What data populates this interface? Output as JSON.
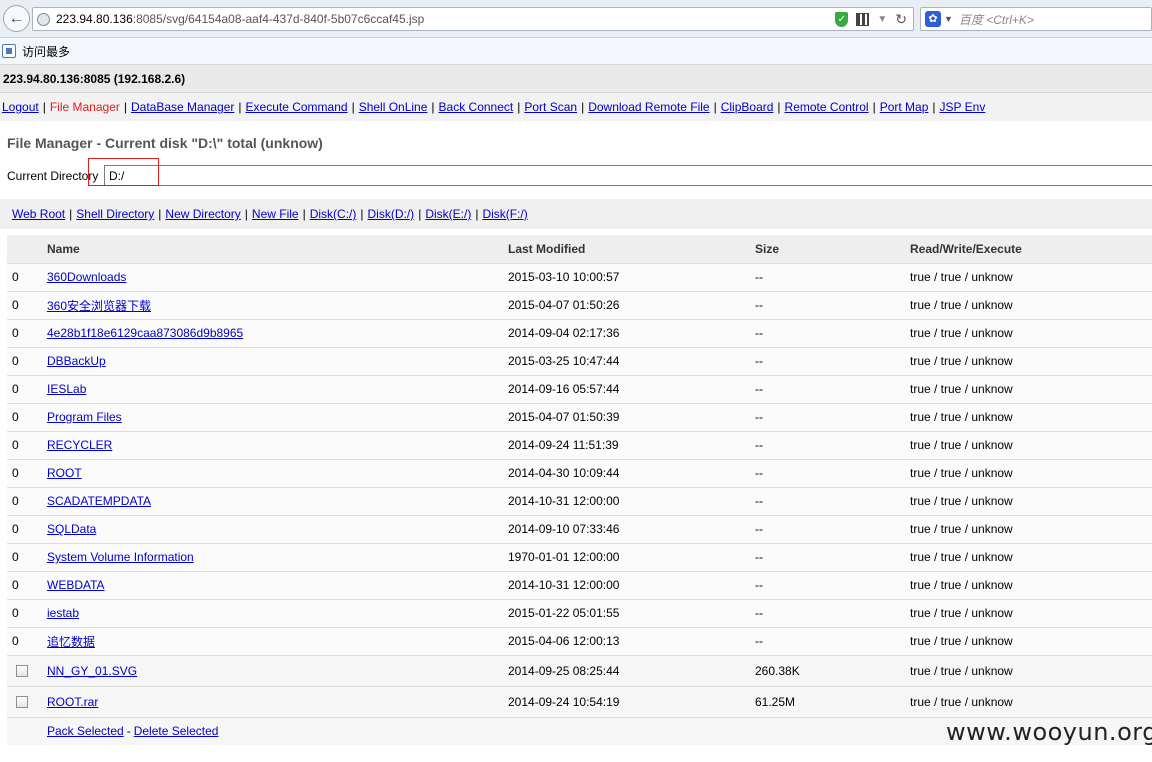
{
  "browser": {
    "url_host": "223.94.80.136",
    "url_rest": ":8085/svg/64154a08-aaf4-437d-840f-5b07c6ccaf45.jsp",
    "search_placeholder": "百度 <Ctrl+K>",
    "bookmark_label": "访问最多"
  },
  "page": {
    "host_line": "223.94.80.136:8085 (192.168.2.6)",
    "nav": [
      {
        "label": "Logout",
        "active": false
      },
      {
        "label": "File Manager",
        "active": true
      },
      {
        "label": "DataBase Manager",
        "active": false
      },
      {
        "label": "Execute Command",
        "active": false
      },
      {
        "label": "Shell OnLine",
        "active": false
      },
      {
        "label": "Back Connect",
        "active": false
      },
      {
        "label": "Port Scan",
        "active": false
      },
      {
        "label": "Download Remote File",
        "active": false
      },
      {
        "label": "ClipBoard",
        "active": false
      },
      {
        "label": "Remote Control",
        "active": false
      },
      {
        "label": "Port Map",
        "active": false
      },
      {
        "label": "JSP Env",
        "active": false
      }
    ],
    "title": "File Manager - Current disk \"D:\\\" total (unknow)",
    "current_dir_label": "Current Directory",
    "current_dir_value": "D:/",
    "quick_links": [
      "Web Root",
      "Shell Directory",
      "New Directory",
      "New File",
      "Disk(C:/)",
      "Disk(D:/)",
      "Disk(E:/)",
      "Disk(F:/)"
    ],
    "table": {
      "headers": [
        "",
        "Name",
        "Last Modified",
        "Size",
        "Read/Write/Execute"
      ],
      "dirs": [
        {
          "count": "0",
          "name": "360Downloads",
          "modified": "2015-03-10 10:00:57",
          "size": "--",
          "rwx": "true / true / unknow"
        },
        {
          "count": "0",
          "name": "360安全浏览器下载",
          "modified": "2015-04-07 01:50:26",
          "size": "--",
          "rwx": "true / true / unknow"
        },
        {
          "count": "0",
          "name": "4e28b1f18e6129caa873086d9b8965",
          "modified": "2014-09-04 02:17:36",
          "size": "--",
          "rwx": "true / true / unknow"
        },
        {
          "count": "0",
          "name": "DBBackUp",
          "modified": "2015-03-25 10:47:44",
          "size": "--",
          "rwx": "true / true / unknow"
        },
        {
          "count": "0",
          "name": "IESLab",
          "modified": "2014-09-16 05:57:44",
          "size": "--",
          "rwx": "true / true / unknow"
        },
        {
          "count": "0",
          "name": "Program Files",
          "modified": "2015-04-07 01:50:39",
          "size": "--",
          "rwx": "true / true / unknow"
        },
        {
          "count": "0",
          "name": "RECYCLER",
          "modified": "2014-09-24 11:51:39",
          "size": "--",
          "rwx": "true / true / unknow"
        },
        {
          "count": "0",
          "name": "ROOT",
          "modified": "2014-04-30 10:09:44",
          "size": "--",
          "rwx": "true / true / unknow"
        },
        {
          "count": "0",
          "name": "SCADATEMPDATA",
          "modified": "2014-10-31 12:00:00",
          "size": "--",
          "rwx": "true / true / unknow"
        },
        {
          "count": "0",
          "name": "SQLData",
          "modified": "2014-09-10 07:33:46",
          "size": "--",
          "rwx": "true / true / unknow"
        },
        {
          "count": "0",
          "name": "System Volume Information",
          "modified": "1970-01-01 12:00:00",
          "size": "--",
          "rwx": "true / true / unknow"
        },
        {
          "count": "0",
          "name": "WEBDATA",
          "modified": "2014-10-31 12:00:00",
          "size": "--",
          "rwx": "true / true / unknow"
        },
        {
          "count": "0",
          "name": "iestab",
          "modified": "2015-01-22 05:01:55",
          "size": "--",
          "rwx": "true / true / unknow"
        },
        {
          "count": "0",
          "name": "追忆数据",
          "modified": "2015-04-06 12:00:13",
          "size": "--",
          "rwx": "true / true / unknow"
        }
      ],
      "files": [
        {
          "name": "NN_GY_01.SVG",
          "modified": "2014-09-25 08:25:44",
          "size": "260.38K",
          "rwx": "true / true / unknow"
        },
        {
          "name": "ROOT.rar",
          "modified": "2014-09-24 10:54:19",
          "size": "61.25M",
          "rwx": "true / true / unknow"
        }
      ],
      "footer": {
        "pack": "Pack Selected",
        "sep": "-",
        "delete": "Delete Selected"
      }
    },
    "watermark": "www.wooyun.org"
  },
  "colors": {
    "link": "#0000cc",
    "active_link": "#e02020",
    "highlight": "#d62020"
  }
}
